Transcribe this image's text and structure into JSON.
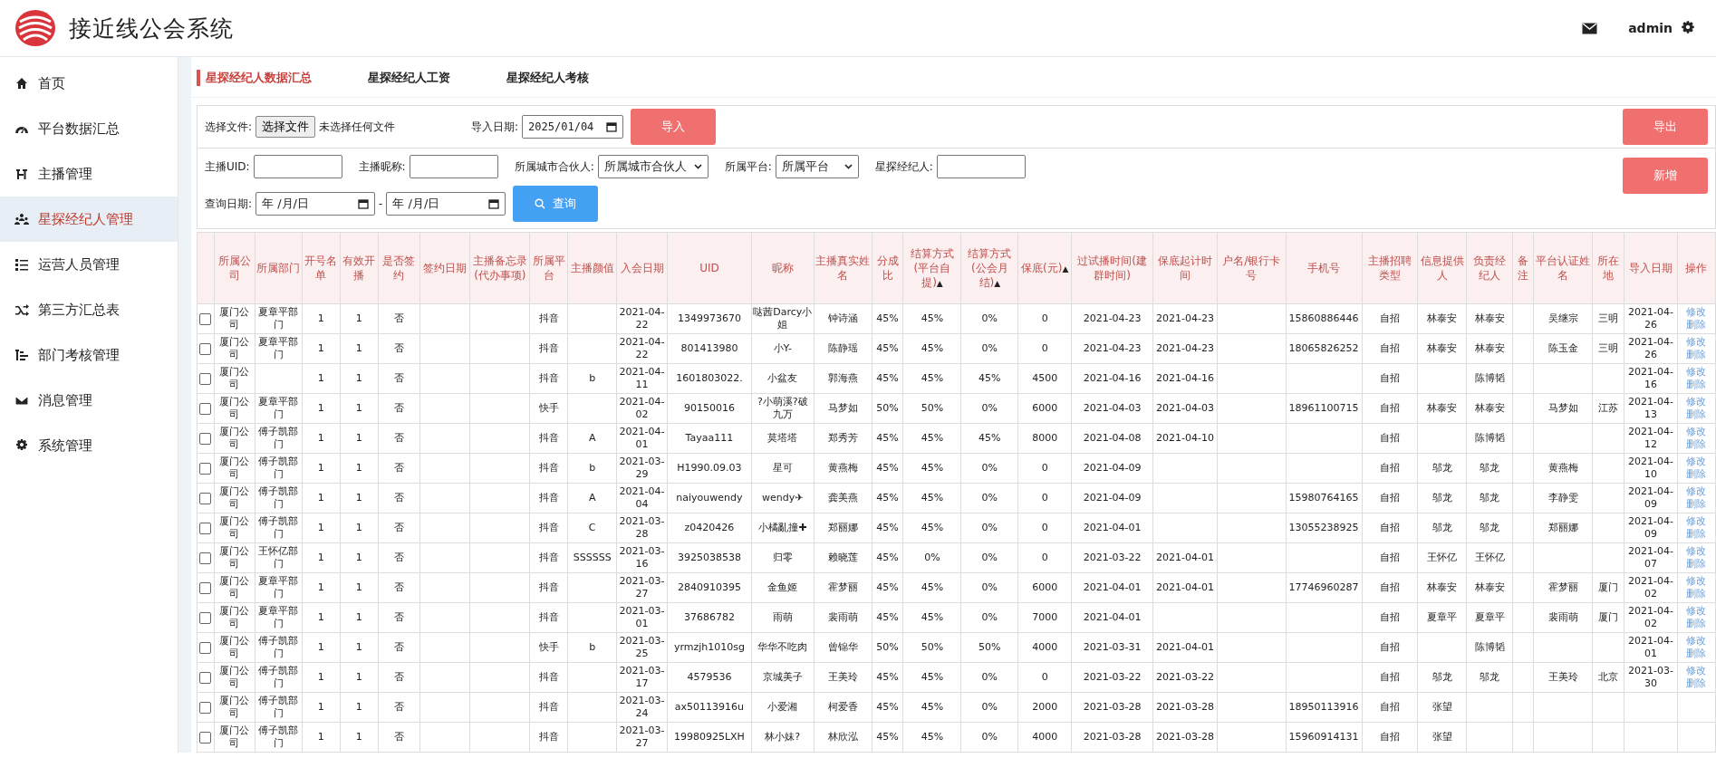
{
  "header": {
    "title": "接近线公会系统",
    "user": "admin"
  },
  "sidebar": {
    "items": [
      {
        "label": "首页",
        "selected": false
      },
      {
        "label": "平台数据汇总",
        "selected": false
      },
      {
        "label": "主播管理",
        "selected": false
      },
      {
        "label": "星探经纪人管理",
        "selected": true
      },
      {
        "label": "运营人员管理",
        "selected": false
      },
      {
        "label": "第三方汇总表",
        "selected": false
      },
      {
        "label": "部门考核管理",
        "selected": false
      },
      {
        "label": "消息管理",
        "selected": false
      },
      {
        "label": "系统管理",
        "selected": false
      }
    ]
  },
  "tabs": [
    {
      "label": "星探经纪人数据汇总",
      "selected": true
    },
    {
      "label": "星探经纪人工资",
      "selected": false
    },
    {
      "label": "星探经纪人考核",
      "selected": false
    }
  ],
  "import_bar": {
    "file_label": "选择文件:",
    "file_button": "选择文件",
    "file_status": "未选择任何文件",
    "date_label": "导入日期:",
    "date_value": "2025/01/04",
    "import_button": "导入",
    "export_button": "导出"
  },
  "filters": {
    "uid_label": "主播UID:",
    "nickname_label": "主播昵称:",
    "partner_label": "所属城市合伙人:",
    "partner_value": "所属城市合伙人",
    "platform_label": "所属平台:",
    "platform_value": "所属平台",
    "scout_label": "星探经纪人:",
    "date_label": "查询日期:",
    "date_from": "年 /月/日",
    "date_sep": "-",
    "date_to": "年 /月/日",
    "search_button": "查询",
    "add_button": "新增"
  },
  "table": {
    "columns": [
      {
        "label": "所属公司"
      },
      {
        "label": "所属部门"
      },
      {
        "label": "开号名单"
      },
      {
        "label": "有效开播"
      },
      {
        "label": "是否签约"
      },
      {
        "label": "签约日期"
      },
      {
        "label": "主播备忘录(代办事项)"
      },
      {
        "label": "所属平台"
      },
      {
        "label": "主播颜值"
      },
      {
        "label": "入会日期"
      },
      {
        "label": "UID"
      },
      {
        "label": "昵称"
      },
      {
        "label": "主播真实姓名"
      },
      {
        "label": "分成比"
      },
      {
        "label": "结算方式(平台自提)",
        "sort_mark": "▲"
      },
      {
        "label": "结算方式(公会月结)",
        "sort_mark": "▲"
      },
      {
        "label": "保底(元)",
        "sort_mark": "▲"
      },
      {
        "label": "过试播时间(建群时间)"
      },
      {
        "label": "保底起计时间"
      },
      {
        "label": "户名/银行卡号"
      },
      {
        "label": "手机号"
      },
      {
        "label": "主播招聘类型"
      },
      {
        "label": "信息提供人"
      },
      {
        "label": "负责经纪人"
      },
      {
        "label": "备注"
      },
      {
        "label": "平台认证姓名"
      },
      {
        "label": "所在地"
      },
      {
        "label": "导入日期"
      },
      {
        "label": "操作"
      }
    ],
    "rows": [
      {
        "checked": false,
        "cells": [
          "厦门公司",
          "夏章平部门",
          "1",
          "1",
          "否",
          "",
          "",
          "抖音",
          "",
          "2021-04-22",
          "1349973670",
          "哒茜Darcy小姐",
          "钟诗涵",
          "45%",
          "45%",
          "0%",
          "0",
          "2021-04-23",
          "2021-04-23",
          "",
          "15860886446",
          "自招",
          "林泰安",
          "林泰安",
          "",
          "吴继宗",
          "三明",
          "2021-04-26"
        ],
        "actions": [
          "修改",
          "删除"
        ]
      },
      {
        "checked": false,
        "cells": [
          "厦门公司",
          "夏章平部门",
          "1",
          "1",
          "否",
          "",
          "",
          "抖音",
          "",
          "2021-04-22",
          "801413980",
          "小Y-",
          "陈静瑶",
          "45%",
          "45%",
          "0%",
          "0",
          "2021-04-23",
          "2021-04-23",
          "",
          "18065826252",
          "自招",
          "林泰安",
          "林泰安",
          "",
          "陈玉金",
          "三明",
          "2021-04-26"
        ],
        "actions": [
          "修改",
          "删除"
        ]
      },
      {
        "checked": false,
        "cells": [
          "厦门公司",
          "",
          "1",
          "1",
          "否",
          "",
          "",
          "抖音",
          "b",
          "2021-04-11",
          "1601803022.",
          "小盆友",
          "郭海燕",
          "45%",
          "45%",
          "45%",
          "4500",
          "2021-04-16",
          "2021-04-16",
          "",
          "",
          "自招",
          "",
          "陈博韬",
          "",
          "",
          "",
          "2021-04-16"
        ],
        "actions": [
          "修改",
          "删除"
        ]
      },
      {
        "checked": false,
        "cells": [
          "厦门公司",
          "夏章平部门",
          "1",
          "1",
          "否",
          "",
          "",
          "快手",
          "",
          "2021-04-02",
          "90150016",
          "?小萌溪?破九万",
          "马梦如",
          "50%",
          "50%",
          "0%",
          "6000",
          "2021-04-03",
          "2021-04-03",
          "",
          "18961100715",
          "自招",
          "林泰安",
          "林泰安",
          "",
          "马梦如",
          "江苏",
          "2021-04-13"
        ],
        "actions": [
          "修改",
          "删除"
        ]
      },
      {
        "checked": false,
        "cells": [
          "厦门公司",
          "傅子凯部门",
          "1",
          "1",
          "否",
          "",
          "",
          "抖音",
          "A",
          "2021-04-01",
          "Tayaa111",
          "莫塔塔",
          "郑秀芳",
          "45%",
          "45%",
          "45%",
          "8000",
          "2021-04-08",
          "2021-04-10",
          "",
          "",
          "自招",
          "",
          "陈博韬",
          "",
          "",
          "",
          "2021-04-12"
        ],
        "actions": [
          "修改",
          "删除"
        ]
      },
      {
        "checked": false,
        "cells": [
          "厦门公司",
          "傅子凯部门",
          "1",
          "1",
          "否",
          "",
          "",
          "抖音",
          "b",
          "2021-03-29",
          "H1990.09.03",
          "星可",
          "黄燕梅",
          "45%",
          "45%",
          "0%",
          "0",
          "2021-04-09",
          "",
          "",
          "",
          "自招",
          "邬龙",
          "邬龙",
          "",
          "黄燕梅",
          "",
          "2021-04-10"
        ],
        "actions": [
          "修改",
          "删除"
        ]
      },
      {
        "checked": false,
        "cells": [
          "厦门公司",
          "傅子凯部门",
          "1",
          "1",
          "否",
          "",
          "",
          "抖音",
          "A",
          "2021-04-04",
          "naiyouwendy",
          "wendy✈",
          "龚美燕",
          "45%",
          "45%",
          "0%",
          "0",
          "2021-04-09",
          "",
          "",
          "15980764165",
          "自招",
          "邬龙",
          "邬龙",
          "",
          "李静雯",
          "",
          "2021-04-09"
        ],
        "actions": [
          "修改",
          "删除"
        ]
      },
      {
        "checked": false,
        "cells": [
          "厦门公司",
          "傅子凯部门",
          "1",
          "1",
          "否",
          "",
          "",
          "抖音",
          "C",
          "2021-03-28",
          "z0420426",
          "小橘亂撞✚",
          "郑丽娜",
          "45%",
          "45%",
          "0%",
          "0",
          "2021-04-01",
          "",
          "",
          "13055238925",
          "自招",
          "邬龙",
          "邬龙",
          "",
          "郑丽娜",
          "",
          "2021-04-09"
        ],
        "actions": [
          "修改",
          "删除"
        ]
      },
      {
        "checked": false,
        "cells": [
          "厦门公司",
          "王怀亿部门",
          "1",
          "1",
          "否",
          "",
          "",
          "抖音",
          "SSSSSS",
          "2021-03-16",
          "3925038538",
          "归零",
          "赖晓莲",
          "45%",
          "0%",
          "0%",
          "0",
          "2021-03-22",
          "2021-04-01",
          "",
          "",
          "自招",
          "王怀亿",
          "王怀亿",
          "",
          "",
          "",
          "2021-04-07"
        ],
        "actions": [
          "修改",
          "删除"
        ]
      },
      {
        "checked": false,
        "cells": [
          "厦门公司",
          "夏章平部门",
          "1",
          "1",
          "否",
          "",
          "",
          "抖音",
          "",
          "2021-03-27",
          "2840910395",
          "金鱼姬",
          "霍梦丽",
          "45%",
          "45%",
          "0%",
          "6000",
          "2021-04-01",
          "2021-04-01",
          "",
          "17746960287",
          "自招",
          "林泰安",
          "林泰安",
          "",
          "霍梦丽",
          "厦门",
          "2021-04-02"
        ],
        "actions": [
          "修改",
          "删除"
        ]
      },
      {
        "checked": false,
        "cells": [
          "厦门公司",
          "夏章平部门",
          "1",
          "1",
          "否",
          "",
          "",
          "抖音",
          "",
          "2021-03-01",
          "37686782",
          "雨萌",
          "裴雨萌",
          "45%",
          "45%",
          "0%",
          "7000",
          "2021-04-01",
          "",
          "",
          "",
          "自招",
          "夏章平",
          "夏章平",
          "",
          "裴雨萌",
          "厦门",
          "2021-04-02"
        ],
        "actions": [
          "修改",
          "删除"
        ]
      },
      {
        "checked": false,
        "cells": [
          "厦门公司",
          "傅子凯部门",
          "1",
          "1",
          "否",
          "",
          "",
          "快手",
          "b",
          "2021-03-25",
          "yrmzjh1010sg",
          "华华不吃肉",
          "曾锦华",
          "50%",
          "50%",
          "50%",
          "4000",
          "2021-03-31",
          "2021-04-01",
          "",
          "",
          "自招",
          "",
          "陈博韬",
          "",
          "",
          "",
          "2021-04-01"
        ],
        "actions": [
          "修改",
          "删除"
        ]
      },
      {
        "checked": false,
        "cells": [
          "厦门公司",
          "傅子凯部门",
          "1",
          "1",
          "否",
          "",
          "",
          "抖音",
          "",
          "2021-03-17",
          "4579536",
          "京城美子",
          "王美玲",
          "45%",
          "45%",
          "0%",
          "0",
          "2021-03-22",
          "2021-03-22",
          "",
          "",
          "自招",
          "邬龙",
          "邬龙",
          "",
          "王美玲",
          "北京",
          "2021-03-30"
        ],
        "actions": [
          "修改",
          "删除"
        ]
      },
      {
        "checked": false,
        "cells": [
          "厦门公司",
          "傅子凯部门",
          "1",
          "1",
          "否",
          "",
          "",
          "抖音",
          "",
          "2021-03-24",
          "ax50113916u",
          "小爱湘",
          "柯爱香",
          "45%",
          "45%",
          "0%",
          "2000",
          "2021-03-28",
          "2021-03-28",
          "",
          "18950113916",
          "自招",
          "张望"
        ]
      },
      {
        "checked": false,
        "cells": [
          "厦门公司",
          "傅子凯部门",
          "1",
          "1",
          "否",
          "",
          "",
          "抖音",
          "",
          "2021-03-27",
          "19980925LXH",
          "林小妹?",
          "林欣泓",
          "45%",
          "45%",
          "0%",
          "4000",
          "2021-03-28",
          "2021-03-28",
          "",
          "15960914131",
          "自招",
          "张望"
        ]
      }
    ]
  }
}
